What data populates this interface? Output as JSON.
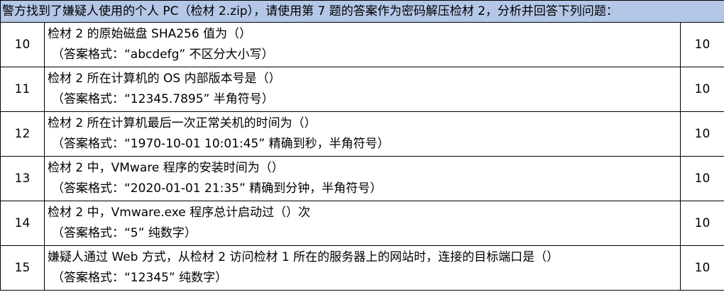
{
  "header": "警方找到了嫌疑人使用的个人 PC（检材 2.zip），请使用第 7 题的答案作为密码解压检材 2，分析并回答下列问题：",
  "questions": [
    {
      "num": "10",
      "question": "检材 2 的原始磁盘 SHA256 值为（）",
      "format": "（答案格式：“abcdefg” 不区分大小写）",
      "score": "10"
    },
    {
      "num": "11",
      "question": "检材 2 所在计算机的 OS 内部版本号是（）",
      "format": "（答案格式：“12345.7895” 半角符号）",
      "score": "10"
    },
    {
      "num": "12",
      "question": "检材 2 所在计算机最后一次正常关机的时间为（）",
      "format": "（答案格式：“1970-10-01 10:01:45”  精确到秒，半角符号）",
      "score": "10"
    },
    {
      "num": "13",
      "question": "检材 2 中，VMware 程序的安装时间为（）",
      "format": "（答案格式：“2020-01-01 21:35”  精确到分钟，半角符号）",
      "score": "10"
    },
    {
      "num": "14",
      "question": "检材 2 中，Vmware.exe 程序总计启动过（）次",
      "format": "（答案格式：“5” 纯数字）",
      "score": "10"
    },
    {
      "num": "15",
      "question": "嫌疑人通过 Web 方式，从检材 2 访问检材 1 所在的服务器上的网站时，连接的目标端口是（）",
      "format": "（答案格式：“12345” 纯数字）",
      "score": "10"
    }
  ],
  "colors": {
    "header_bg": "#b4c7e7",
    "border": "#000000"
  }
}
